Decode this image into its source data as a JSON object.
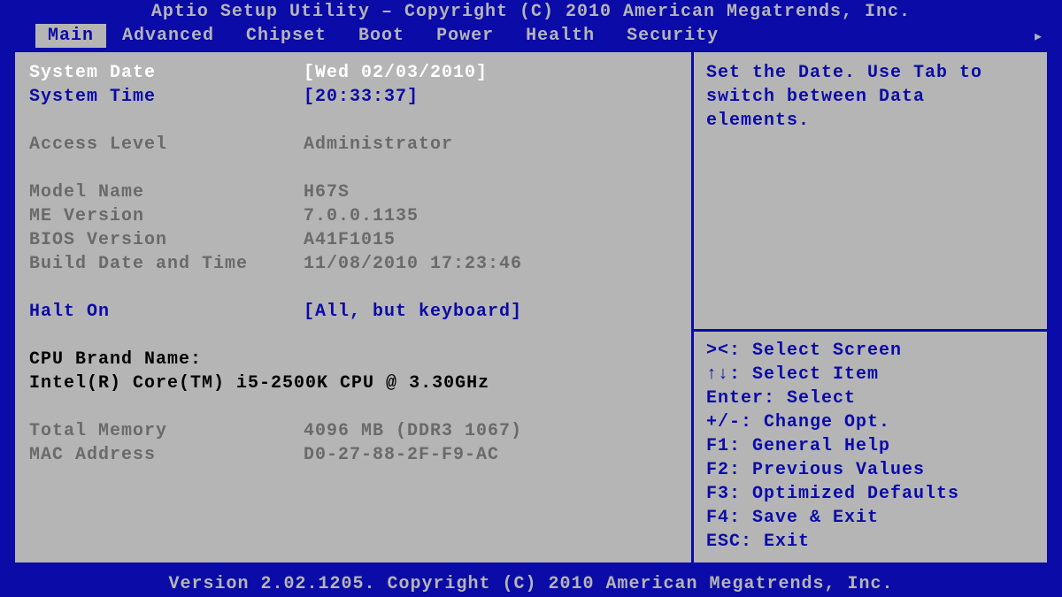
{
  "header_title": "Aptio Setup Utility – Copyright (C) 2010 American Megatrends, Inc.",
  "tabs": [
    "Main",
    "Advanced",
    "Chipset",
    "Boot",
    "Power",
    "Health",
    "Security"
  ],
  "active_tab": "Main",
  "main": {
    "system_date_label": "System Date",
    "system_date_value": "[Wed 02/03/2010]",
    "system_time_label": "System Time",
    "system_time_value": "[20:33:37]",
    "access_level_label": "Access Level",
    "access_level_value": "Administrator",
    "model_name_label": "Model Name",
    "model_name_value": "H67S",
    "me_version_label": "ME Version",
    "me_version_value": "7.0.0.1135",
    "bios_version_label": "BIOS Version",
    "bios_version_value": "A41F1015",
    "build_date_label": "Build Date and Time",
    "build_date_value": "11/08/2010 17:23:46",
    "halt_on_label": "Halt On",
    "halt_on_value": "[All, but keyboard]",
    "cpu_brand_label": "CPU Brand Name:",
    "cpu_brand_value": "Intel(R) Core(TM) i5-2500K CPU @ 3.30GHz",
    "total_memory_label": "Total Memory",
    "total_memory_value": "4096 MB (DDR3 1067)",
    "mac_label": "MAC Address",
    "mac_value": "D0-27-88-2F-F9-AC"
  },
  "help": {
    "description": "Set the Date. Use Tab to switch between Data elements.",
    "keys": [
      "><: Select Screen",
      "↑↓: Select Item",
      "Enter: Select",
      "+/-: Change Opt.",
      "F1: General Help",
      "F2: Previous Values",
      "F3: Optimized Defaults",
      "F4: Save & Exit",
      "ESC: Exit"
    ]
  },
  "footer": "Version 2.02.1205. Copyright (C) 2010 American Megatrends, Inc."
}
